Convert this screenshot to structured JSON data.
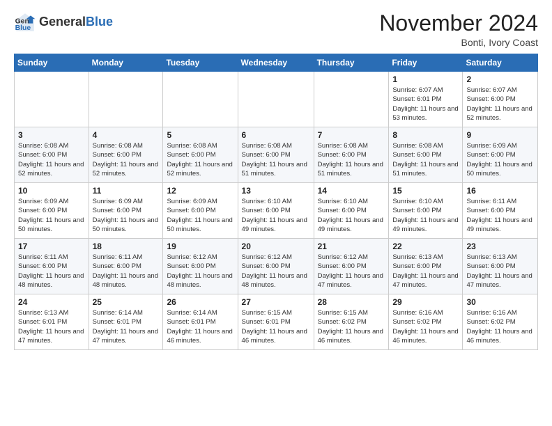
{
  "header": {
    "logo_general": "General",
    "logo_blue": "Blue",
    "month_title": "November 2024",
    "location": "Bonti, Ivory Coast"
  },
  "weekdays": [
    "Sunday",
    "Monday",
    "Tuesday",
    "Wednesday",
    "Thursday",
    "Friday",
    "Saturday"
  ],
  "weeks": [
    [
      {
        "day": "",
        "sunrise": "",
        "sunset": "",
        "daylight": ""
      },
      {
        "day": "",
        "sunrise": "",
        "sunset": "",
        "daylight": ""
      },
      {
        "day": "",
        "sunrise": "",
        "sunset": "",
        "daylight": ""
      },
      {
        "day": "",
        "sunrise": "",
        "sunset": "",
        "daylight": ""
      },
      {
        "day": "",
        "sunrise": "",
        "sunset": "",
        "daylight": ""
      },
      {
        "day": "1",
        "sunrise": "Sunrise: 6:07 AM",
        "sunset": "Sunset: 6:01 PM",
        "daylight": "Daylight: 11 hours and 53 minutes."
      },
      {
        "day": "2",
        "sunrise": "Sunrise: 6:07 AM",
        "sunset": "Sunset: 6:00 PM",
        "daylight": "Daylight: 11 hours and 52 minutes."
      }
    ],
    [
      {
        "day": "3",
        "sunrise": "Sunrise: 6:08 AM",
        "sunset": "Sunset: 6:00 PM",
        "daylight": "Daylight: 11 hours and 52 minutes."
      },
      {
        "day": "4",
        "sunrise": "Sunrise: 6:08 AM",
        "sunset": "Sunset: 6:00 PM",
        "daylight": "Daylight: 11 hours and 52 minutes."
      },
      {
        "day": "5",
        "sunrise": "Sunrise: 6:08 AM",
        "sunset": "Sunset: 6:00 PM",
        "daylight": "Daylight: 11 hours and 52 minutes."
      },
      {
        "day": "6",
        "sunrise": "Sunrise: 6:08 AM",
        "sunset": "Sunset: 6:00 PM",
        "daylight": "Daylight: 11 hours and 51 minutes."
      },
      {
        "day": "7",
        "sunrise": "Sunrise: 6:08 AM",
        "sunset": "Sunset: 6:00 PM",
        "daylight": "Daylight: 11 hours and 51 minutes."
      },
      {
        "day": "8",
        "sunrise": "Sunrise: 6:08 AM",
        "sunset": "Sunset: 6:00 PM",
        "daylight": "Daylight: 11 hours and 51 minutes."
      },
      {
        "day": "9",
        "sunrise": "Sunrise: 6:09 AM",
        "sunset": "Sunset: 6:00 PM",
        "daylight": "Daylight: 11 hours and 50 minutes."
      }
    ],
    [
      {
        "day": "10",
        "sunrise": "Sunrise: 6:09 AM",
        "sunset": "Sunset: 6:00 PM",
        "daylight": "Daylight: 11 hours and 50 minutes."
      },
      {
        "day": "11",
        "sunrise": "Sunrise: 6:09 AM",
        "sunset": "Sunset: 6:00 PM",
        "daylight": "Daylight: 11 hours and 50 minutes."
      },
      {
        "day": "12",
        "sunrise": "Sunrise: 6:09 AM",
        "sunset": "Sunset: 6:00 PM",
        "daylight": "Daylight: 11 hours and 50 minutes."
      },
      {
        "day": "13",
        "sunrise": "Sunrise: 6:10 AM",
        "sunset": "Sunset: 6:00 PM",
        "daylight": "Daylight: 11 hours and 49 minutes."
      },
      {
        "day": "14",
        "sunrise": "Sunrise: 6:10 AM",
        "sunset": "Sunset: 6:00 PM",
        "daylight": "Daylight: 11 hours and 49 minutes."
      },
      {
        "day": "15",
        "sunrise": "Sunrise: 6:10 AM",
        "sunset": "Sunset: 6:00 PM",
        "daylight": "Daylight: 11 hours and 49 minutes."
      },
      {
        "day": "16",
        "sunrise": "Sunrise: 6:11 AM",
        "sunset": "Sunset: 6:00 PM",
        "daylight": "Daylight: 11 hours and 49 minutes."
      }
    ],
    [
      {
        "day": "17",
        "sunrise": "Sunrise: 6:11 AM",
        "sunset": "Sunset: 6:00 PM",
        "daylight": "Daylight: 11 hours and 48 minutes."
      },
      {
        "day": "18",
        "sunrise": "Sunrise: 6:11 AM",
        "sunset": "Sunset: 6:00 PM",
        "daylight": "Daylight: 11 hours and 48 minutes."
      },
      {
        "day": "19",
        "sunrise": "Sunrise: 6:12 AM",
        "sunset": "Sunset: 6:00 PM",
        "daylight": "Daylight: 11 hours and 48 minutes."
      },
      {
        "day": "20",
        "sunrise": "Sunrise: 6:12 AM",
        "sunset": "Sunset: 6:00 PM",
        "daylight": "Daylight: 11 hours and 48 minutes."
      },
      {
        "day": "21",
        "sunrise": "Sunrise: 6:12 AM",
        "sunset": "Sunset: 6:00 PM",
        "daylight": "Daylight: 11 hours and 47 minutes."
      },
      {
        "day": "22",
        "sunrise": "Sunrise: 6:13 AM",
        "sunset": "Sunset: 6:00 PM",
        "daylight": "Daylight: 11 hours and 47 minutes."
      },
      {
        "day": "23",
        "sunrise": "Sunrise: 6:13 AM",
        "sunset": "Sunset: 6:00 PM",
        "daylight": "Daylight: 11 hours and 47 minutes."
      }
    ],
    [
      {
        "day": "24",
        "sunrise": "Sunrise: 6:13 AM",
        "sunset": "Sunset: 6:01 PM",
        "daylight": "Daylight: 11 hours and 47 minutes."
      },
      {
        "day": "25",
        "sunrise": "Sunrise: 6:14 AM",
        "sunset": "Sunset: 6:01 PM",
        "daylight": "Daylight: 11 hours and 47 minutes."
      },
      {
        "day": "26",
        "sunrise": "Sunrise: 6:14 AM",
        "sunset": "Sunset: 6:01 PM",
        "daylight": "Daylight: 11 hours and 46 minutes."
      },
      {
        "day": "27",
        "sunrise": "Sunrise: 6:15 AM",
        "sunset": "Sunset: 6:01 PM",
        "daylight": "Daylight: 11 hours and 46 minutes."
      },
      {
        "day": "28",
        "sunrise": "Sunrise: 6:15 AM",
        "sunset": "Sunset: 6:02 PM",
        "daylight": "Daylight: 11 hours and 46 minutes."
      },
      {
        "day": "29",
        "sunrise": "Sunrise: 6:16 AM",
        "sunset": "Sunset: 6:02 PM",
        "daylight": "Daylight: 11 hours and 46 minutes."
      },
      {
        "day": "30",
        "sunrise": "Sunrise: 6:16 AM",
        "sunset": "Sunset: 6:02 PM",
        "daylight": "Daylight: 11 hours and 46 minutes."
      }
    ]
  ]
}
